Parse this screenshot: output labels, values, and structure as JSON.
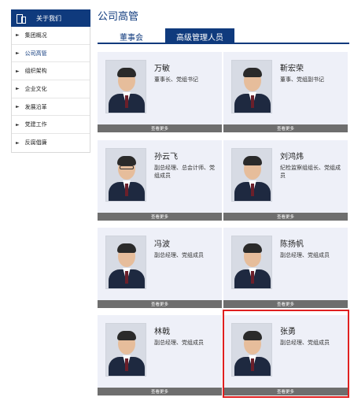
{
  "sidebar": {
    "header": "关于我们",
    "items": [
      {
        "label": "集团概况",
        "active": false
      },
      {
        "label": "公司高管",
        "active": true
      },
      {
        "label": "组织架构",
        "active": false
      },
      {
        "label": "企业文化",
        "active": false
      },
      {
        "label": "发展沿革",
        "active": false
      },
      {
        "label": "党建工作",
        "active": false
      },
      {
        "label": "反腐倡廉",
        "active": false
      }
    ]
  },
  "main": {
    "title": "公司高管",
    "tabs": [
      {
        "label": "董事会",
        "selected": false
      },
      {
        "label": "高级管理人员",
        "selected": true
      }
    ],
    "more_label": "查看更多",
    "people": [
      {
        "name": "万敏",
        "role": "董事长、党组书记"
      },
      {
        "name": "靳宏荣",
        "role": "董事、党组副书记"
      },
      {
        "name": "孙云飞",
        "role": "副总经理、总会计师、党组成员"
      },
      {
        "name": "刘鸿炜",
        "role": "纪检监察组组长、党组成员"
      },
      {
        "name": "冯波",
        "role": "副总经理、党组成员"
      },
      {
        "name": "陈扬帆",
        "role": "副总经理、党组成员"
      },
      {
        "name": "林戟",
        "role": "副总经理、党组成员"
      },
      {
        "name": "张勇",
        "role": "副总经理、党组成员"
      }
    ]
  },
  "colors": {
    "brand": "#0f3a7d",
    "card_bg": "#eef0f8",
    "more_bar": "#6e6e6e",
    "highlight": "#e02020"
  }
}
